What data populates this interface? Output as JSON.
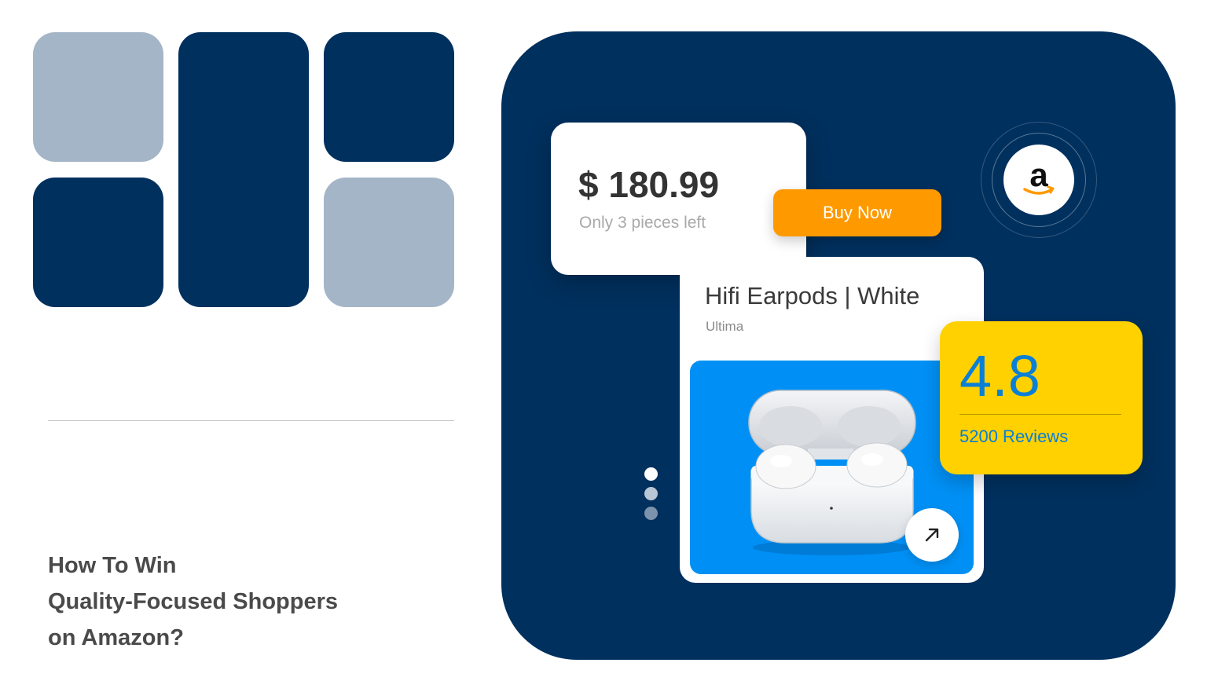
{
  "headline": {
    "line1": "How To Win",
    "line2": "Quality-Focused Shoppers",
    "line3": "on Amazon?"
  },
  "price_card": {
    "price": "$ 180.99",
    "stock_note": "Only 3 pieces left"
  },
  "buy_button": {
    "label": "Buy Now"
  },
  "product": {
    "title": "Hifi Earpods | White",
    "brand": "Ultima"
  },
  "rating": {
    "value": "4.8",
    "reviews": "5200 Reviews"
  },
  "carousel": {
    "dots": 3,
    "active_index": 0
  },
  "icons": {
    "logo": "amazon-logo-icon",
    "open": "arrow-up-right-icon"
  },
  "colors": {
    "navy": "#00305e",
    "light_tile": "#a5b5c8",
    "buy_orange": "#ff9900",
    "rating_yellow": "#ffd100",
    "rating_blue": "#0a7fd6",
    "product_bg_blue": "#0090f5"
  }
}
